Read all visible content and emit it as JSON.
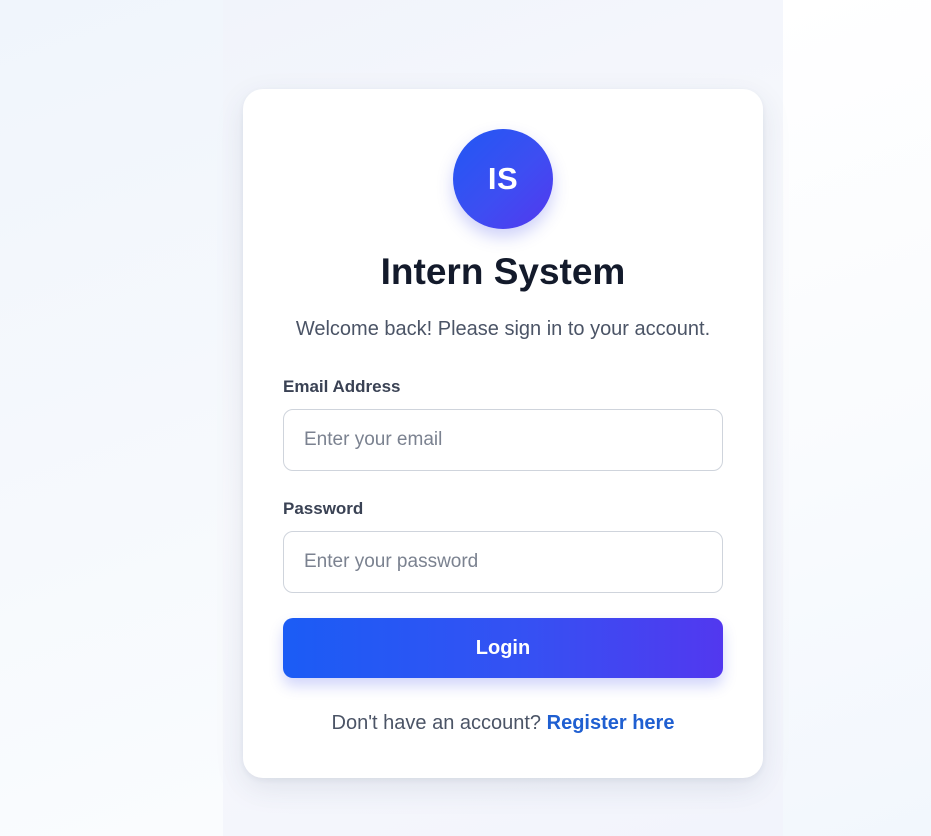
{
  "login_card": {
    "logo_text": "IS",
    "title": "Intern System",
    "subtitle": "Welcome back! Please sign in to your account.",
    "email": {
      "label": "Email Address",
      "value": "",
      "placeholder": "Enter your email"
    },
    "password": {
      "label": "Password",
      "value": "",
      "placeholder": "Enter your password"
    },
    "login_label": "Login",
    "register_prompt": "Don't have an account?",
    "register_link": "Register here"
  },
  "colors": {
    "accent_start": "#1b5cf5",
    "accent_end": "#5238ef",
    "link": "#1f5fd1",
    "title": "#131a2b"
  }
}
